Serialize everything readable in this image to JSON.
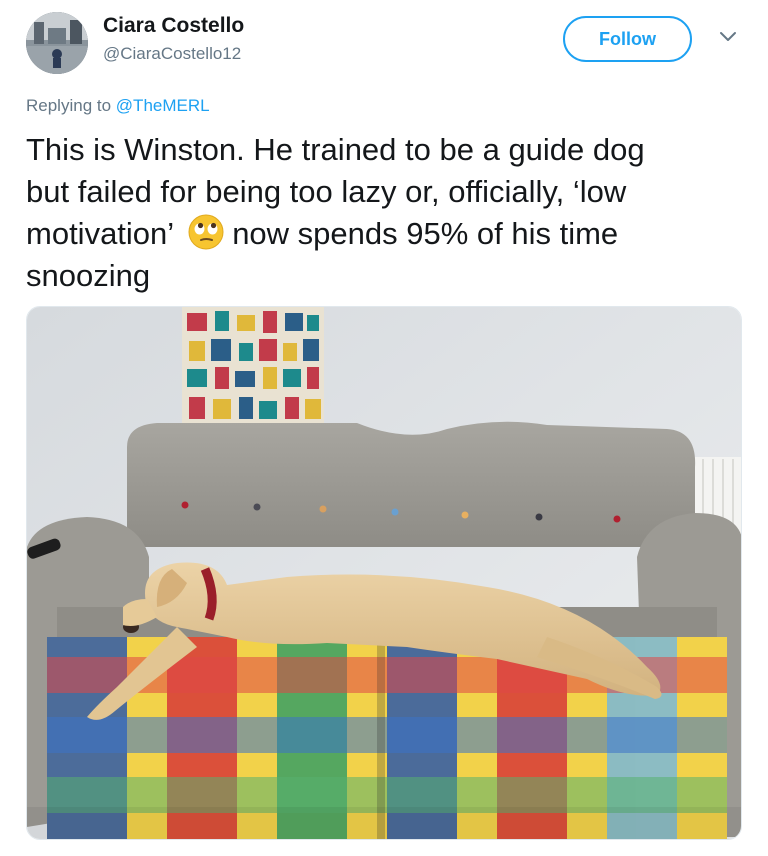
{
  "author": {
    "display_name": "Ciara Costello",
    "handle": "@CiaraCostello12",
    "avatar_icon": "profile-photo"
  },
  "follow_label": "Follow",
  "menu_icon": "chevron-down-icon",
  "reply": {
    "prefix": "Replying to",
    "mention": "@TheMERL"
  },
  "tweet": {
    "line1": "This is Winston. He trained to be a guide dog",
    "line2": "but failed for being too lazy or, officially, ‘low",
    "line3_before_emoji": "motivation’",
    "emoji": "face-with-rolling-eyes",
    "line3_after_emoji": "now spends 95% of his time",
    "line4": "snoozing"
  },
  "media": {
    "kind": "photo",
    "subject": "dog-on-sofa-photo"
  },
  "colors": {
    "accent": "#1da1f2",
    "secondary_text": "#657786",
    "primary_text": "#14171a"
  }
}
